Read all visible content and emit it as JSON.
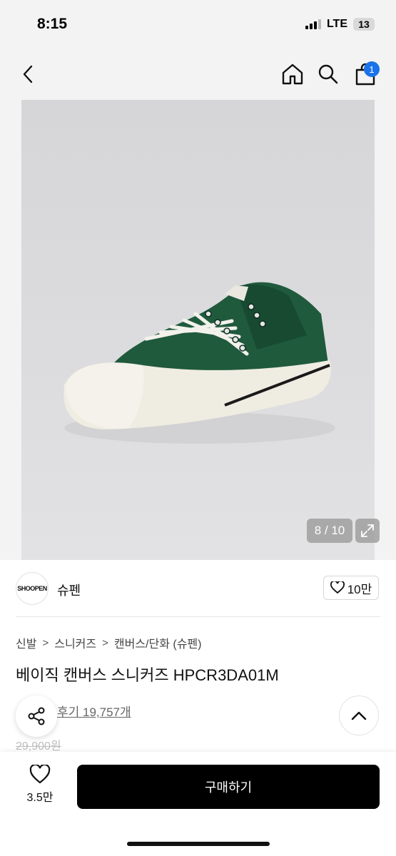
{
  "status_bar": {
    "time": "8:15",
    "network": "LTE",
    "battery": "13"
  },
  "header": {
    "cart_count": "1"
  },
  "gallery": {
    "counter": "8 / 10"
  },
  "brand": {
    "logo_text": "SHOOPEN",
    "name": "슈펜",
    "likes": "10만"
  },
  "breadcrumb": [
    "신발",
    "스니커즈",
    "캔버스/단화 (슈펜)"
  ],
  "product": {
    "title": "베이직 캔버스 스니커즈 HPCR3DA01M",
    "reviews": "후기 19,757개",
    "original_price": "29,900원"
  },
  "bottom_bar": {
    "wish_count": "3.5만",
    "buy_label": "구매하기"
  },
  "colors": {
    "accent": "#000000",
    "badge": "#1a73e8",
    "shoe_upper": "#1f5a3c"
  }
}
